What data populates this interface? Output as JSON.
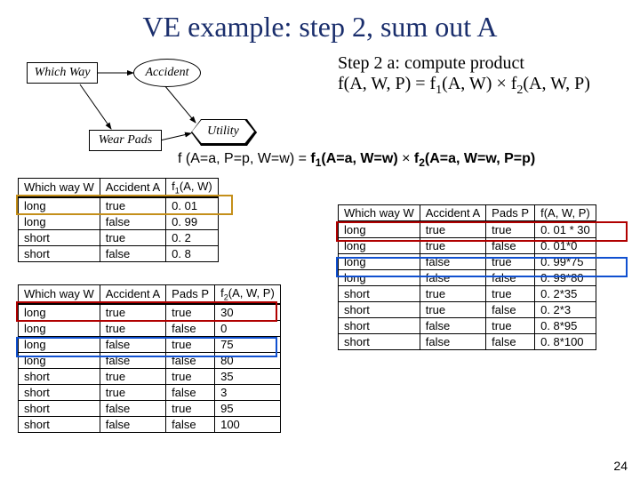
{
  "title": "VE example: step 2, sum out A",
  "page": "24",
  "step": {
    "line1": "Step 2 a: compute product",
    "line2_pre": "f(A, W, P) = f",
    "line2_sub1": "1",
    "line2_mid": "(A, W)  ×  f",
    "line2_sub2": "2",
    "line2_post": "(A, W, P)"
  },
  "diagram": {
    "which_way": "Which Way",
    "accident": "Accident",
    "wear_pads": "Wear Pads",
    "utility": "Utility"
  },
  "equation": {
    "lhs": "f (A=a, P=p, W=w)   =   ",
    "r1a": "f",
    "r1sub": "1",
    "r1b": "(A=a, W=w)",
    "mul": "  ×  ",
    "r2a": "f",
    "r2sub": "2",
    "r2b": "(A=a, W=w, P=p)"
  },
  "f1": {
    "headers": [
      "Which way W",
      "Accident A",
      "f1_hdr"
    ],
    "f1_hdr_pre": "f",
    "f1_hdr_sub": "1",
    "f1_hdr_post": "(A, W)",
    "rows": [
      [
        "long",
        "true",
        "0. 01"
      ],
      [
        "long",
        "false",
        "0. 99"
      ],
      [
        "short",
        "true",
        "0. 2"
      ],
      [
        "short",
        "false",
        "0. 8"
      ]
    ]
  },
  "f2": {
    "headers_pre": [
      "Which way W",
      "Accident A",
      "Pads P"
    ],
    "fhdr_pre": "f",
    "fhdr_sub": "2",
    "fhdr_post": "(A, W, P)",
    "rows": [
      [
        "long",
        "true",
        "true",
        "30"
      ],
      [
        "long",
        "true",
        "false",
        "0"
      ],
      [
        "long",
        "false",
        "true",
        "75"
      ],
      [
        "long",
        "false",
        "false",
        "80"
      ],
      [
        "short",
        "true",
        "true",
        "35"
      ],
      [
        "short",
        "true",
        "false",
        "3"
      ],
      [
        "short",
        "false",
        "true",
        "95"
      ],
      [
        "short",
        "false",
        "false",
        "100"
      ]
    ]
  },
  "f": {
    "headers": [
      "Which way W",
      "Accident A",
      "Pads P",
      "f(A, W, P)"
    ],
    "rows": [
      [
        "long",
        "true",
        "true",
        "0. 01 * 30"
      ],
      [
        "long",
        "true",
        "false",
        "0. 01*0"
      ],
      [
        "long",
        "false",
        "true",
        "0. 99*75"
      ],
      [
        "long",
        "false",
        "false",
        "0. 99*80"
      ],
      [
        "short",
        "true",
        "true",
        "0. 2*35"
      ],
      [
        "short",
        "true",
        "false",
        "0. 2*3"
      ],
      [
        "short",
        "false",
        "true",
        "0. 8*95"
      ],
      [
        "short",
        "false",
        "false",
        "0. 8*100"
      ]
    ]
  }
}
